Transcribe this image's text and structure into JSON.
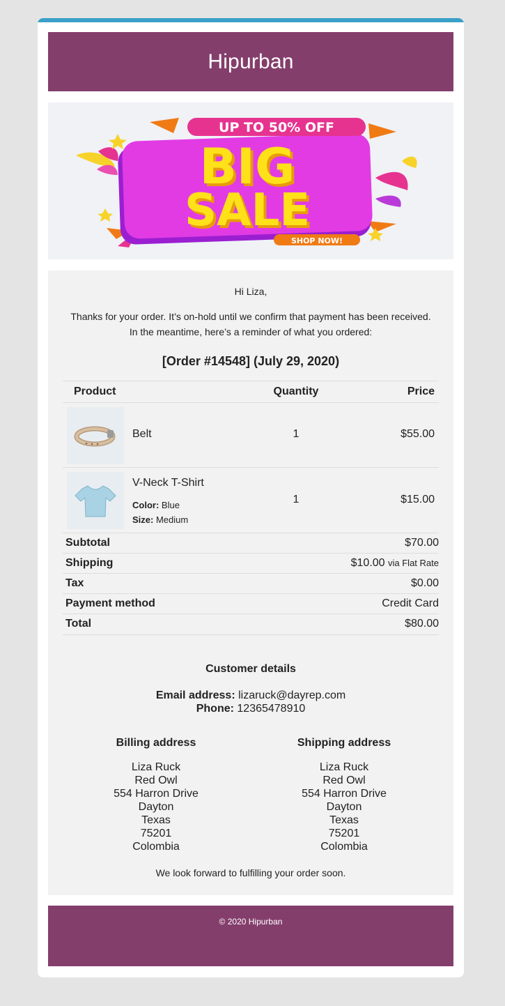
{
  "header": {
    "title": "Hipurban"
  },
  "banner": {
    "top_text": "UP TO 50% OFF",
    "line1": "BIG",
    "line2": "SALE",
    "button": "SHOP NOW!"
  },
  "email": {
    "greeting": "Hi Liza,",
    "intro_line1": "Thanks for your order. It’s on-hold until we confirm that payment has been received.",
    "intro_line2": "In the meantime, here’s a reminder of what you ordered:",
    "order_heading": "[Order #14548] (July 29, 2020)",
    "columns": {
      "product": "Product",
      "quantity": "Quantity",
      "price": "Price"
    },
    "items": [
      {
        "name": "Belt",
        "quantity": "1",
        "price": "$55.00",
        "image_icon": "belt-image"
      },
      {
        "name": "V-Neck T-Shirt",
        "quantity": "1",
        "price": "$15.00",
        "image_icon": "tshirt-image",
        "color_label": "Color:",
        "color_value": "Blue",
        "size_label": "Size:",
        "size_value": "Medium"
      }
    ],
    "totals": [
      {
        "label": "Subtotal",
        "value": "$70.00"
      },
      {
        "label": "Shipping",
        "value": "$10.00",
        "note": "via Flat Rate"
      },
      {
        "label": "Tax",
        "value": "$0.00"
      },
      {
        "label": "Payment method",
        "value": "Credit Card"
      },
      {
        "label": "Total",
        "value": "$80.00"
      }
    ],
    "customer": {
      "title": "Customer details",
      "email_label": "Email address:",
      "email_value": "lizaruck@dayrep.com",
      "phone_label": "Phone:",
      "phone_value": "12365478910"
    },
    "billing": {
      "title": "Billing address",
      "lines": [
        "Liza Ruck",
        "Red Owl",
        "554 Harron Drive",
        "Dayton",
        "Texas",
        "75201",
        "Colombia"
      ]
    },
    "shipping": {
      "title": "Shipping address",
      "lines": [
        "Liza Ruck",
        "Red Owl",
        "554 Harron Drive",
        "Dayton",
        "Texas",
        "75201",
        "Colombia"
      ]
    },
    "closing": "We look forward to fulfilling your order soon."
  },
  "footer": {
    "text": "© 2020 Hipurban"
  },
  "colors": {
    "brand": "#843e6c",
    "accent": "#3aa0c8",
    "content_bg": "#f2f2f2"
  }
}
